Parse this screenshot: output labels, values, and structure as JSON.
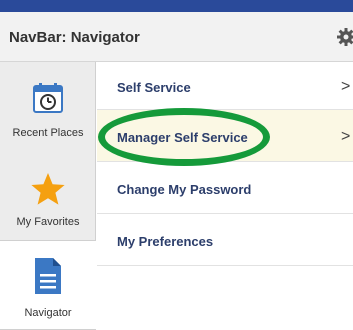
{
  "header": {
    "title": "NavBar: Navigator",
    "settings_icon": "gear-icon"
  },
  "sidebar": {
    "items": [
      {
        "label": "Recent Places",
        "icon": "calendar-clock-icon"
      },
      {
        "label": "My Favorites",
        "icon": "star-icon"
      },
      {
        "label": "Navigator",
        "icon": "document-icon"
      }
    ]
  },
  "menu": {
    "items": [
      {
        "label": "Self Service",
        "chevron": ">"
      },
      {
        "label": "Manager Self Service",
        "chevron": ">"
      },
      {
        "label": "Change My Password"
      },
      {
        "label": "My Preferences"
      }
    ]
  },
  "colors": {
    "topbar": "#2a4a9a",
    "link_text": "#2c3e6b",
    "highlight_row": "#fbf8e4",
    "annotation_oval": "#159a3a",
    "star": "#f5a010",
    "icon_blue": "#3b78c4"
  }
}
